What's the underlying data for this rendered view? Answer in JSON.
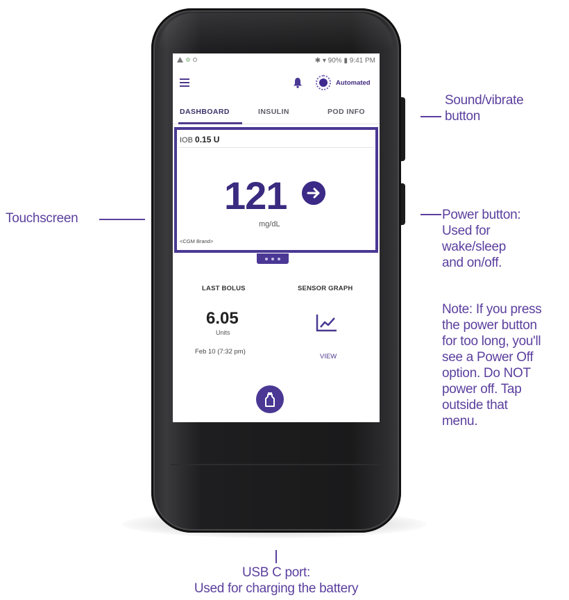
{
  "colors": {
    "accent": "#4a3894",
    "callout_text": "#5b3f9e",
    "phone_body": "#1c1c1e"
  },
  "status_bar": {
    "left_icons": [
      "warning-icon",
      "record-icon",
      "sync-icon"
    ],
    "right_text": "✱ ▾ 90% ▮ 9:41 PM"
  },
  "app_bar": {
    "menu_icon": "hamburger-icon",
    "bell_icon": "bell-icon",
    "mode_label": "Automated"
  },
  "tabs": [
    {
      "label": "DASHBOARD",
      "active": true
    },
    {
      "label": "INSULIN",
      "active": false
    },
    {
      "label": "POD INFO",
      "active": false
    }
  ],
  "glucose_card": {
    "iob_prefix": "IOB",
    "iob_value": "0.15 U",
    "glucose_value": "121",
    "trend_icon": "right-arrow-icon",
    "unit": "mg/dL",
    "cgm_brand": "<CGM Brand>"
  },
  "last_bolus": {
    "title": "LAST BOLUS",
    "value": "6.05",
    "unit": "Units",
    "date": "Feb 10 (7:32 pm)"
  },
  "sensor_graph": {
    "title": "SENSOR GRAPH",
    "icon": "line-chart-icon",
    "link": "VIEW"
  },
  "fab_icon": "bolus-icon",
  "callouts": {
    "sound_vibrate": [
      "Sound/vibrate",
      "button"
    ],
    "touchscreen": "Touchscreen",
    "power_button": [
      "Power button:",
      "Used for",
      "wake/sleep",
      "and on/off."
    ],
    "power_note": [
      "Note: If you press",
      "the power button",
      "for too long, you'll",
      "see a Power Off",
      "option. Do NOT",
      "power off. Tap",
      "outside that",
      "menu."
    ],
    "usb_port": [
      "USB C port:",
      "Used for charging the battery"
    ]
  }
}
